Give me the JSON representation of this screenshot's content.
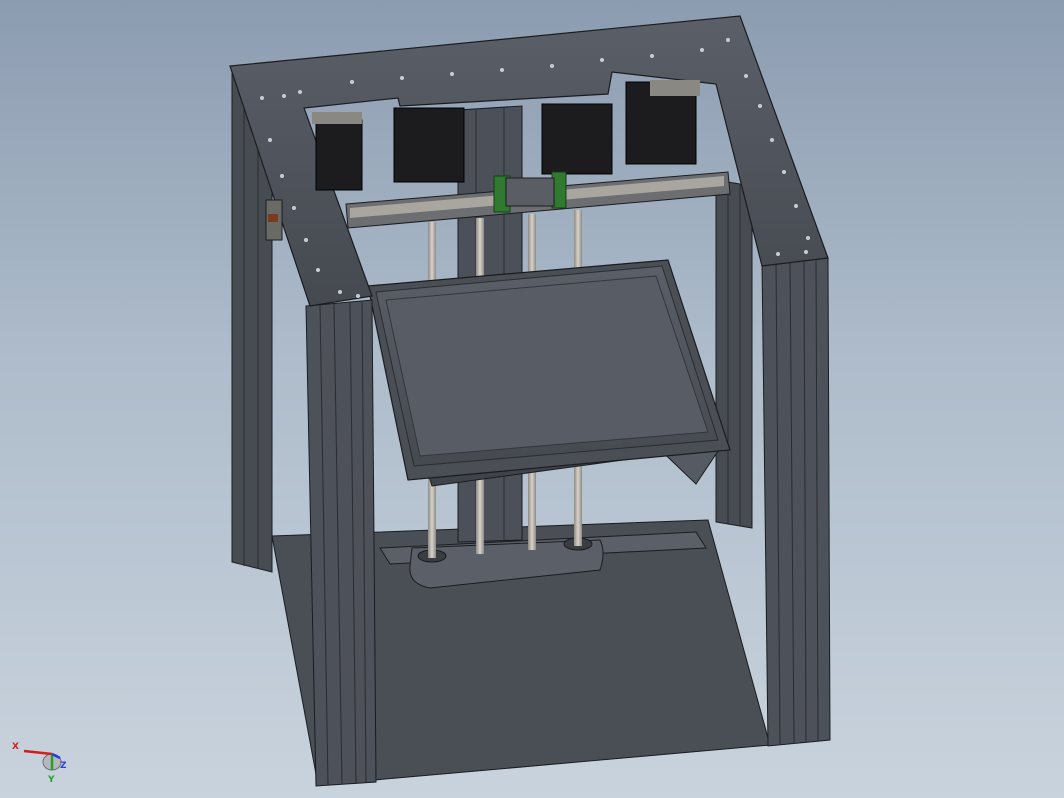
{
  "viewport": {
    "background_top": "#8c9cb0",
    "background_bottom": "#c9d3dd"
  },
  "model": {
    "body_color": "#4f545c",
    "edge_color": "#1a1c20",
    "rod_color": "#b9b5ad",
    "rail_color": "#9c9a94",
    "carriage_color": "#2f7a2f",
    "motor_color": "#1c1c1e"
  },
  "triad": {
    "x_label": "X",
    "y_label": "Y",
    "z_label": "Z",
    "x_color": "#d11f1f",
    "y_color": "#1fa12e",
    "z_color": "#2a3ee0"
  }
}
